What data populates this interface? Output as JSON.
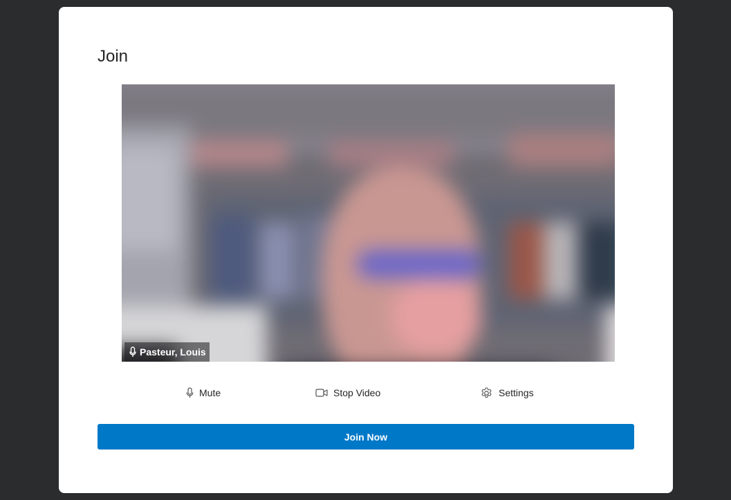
{
  "dialog": {
    "title": "Join"
  },
  "preview": {
    "participant_name": "Pasteur, Louis",
    "mic_icon": "microphone-icon"
  },
  "controls": {
    "mute_label": "Mute",
    "mute_icon": "microphone-icon",
    "video_label": "Stop Video",
    "video_icon": "video-camera-icon",
    "settings_label": "Settings",
    "settings_icon": "gear-icon"
  },
  "join_button": {
    "label": "Join Now"
  },
  "colors": {
    "backdrop": "#2b2c2e",
    "card": "#ffffff",
    "accent": "#0078c8",
    "text": "#242424"
  }
}
